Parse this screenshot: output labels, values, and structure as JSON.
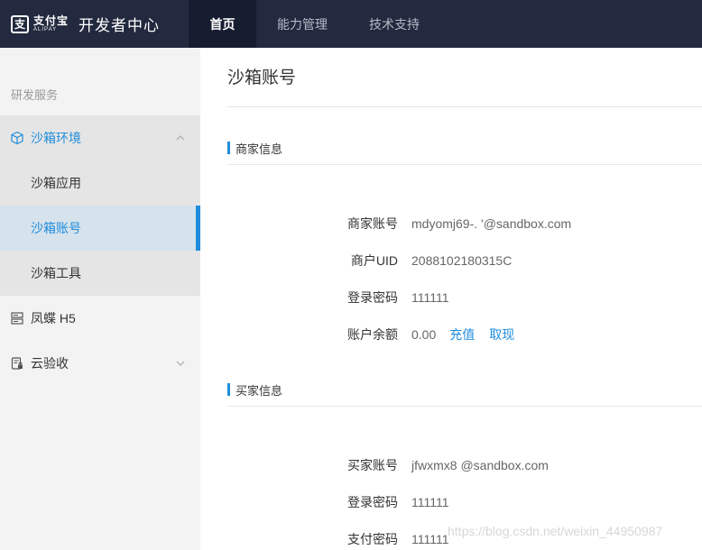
{
  "header": {
    "logo_cn": "支付宝",
    "logo_en": "ALIPAY",
    "title": "开发者中心",
    "tabs": [
      {
        "label": "首页"
      },
      {
        "label": "能力管理"
      },
      {
        "label": "技术支持"
      }
    ]
  },
  "sidebar": {
    "section_label": "研发服务",
    "items": [
      {
        "label": "沙箱环境",
        "icon": "cube-icon",
        "expanded": true
      },
      {
        "label": "沙箱应用"
      },
      {
        "label": "沙箱账号",
        "selected": true
      },
      {
        "label": "沙箱工具"
      },
      {
        "label": "凤蝶 H5",
        "icon": "server-icon"
      },
      {
        "label": "云验收",
        "icon": "clipboard-lock-icon",
        "expanded": false
      }
    ]
  },
  "main": {
    "title": "沙箱账号",
    "merchant": {
      "heading": "商家信息",
      "fields": [
        {
          "label": "商家账号",
          "value": "mdyomj69-. '@sandbox.com"
        },
        {
          "label": "商户UID",
          "value": "2088102180315C"
        },
        {
          "label": "登录密码",
          "value": "111111"
        },
        {
          "label": "账户余额",
          "value": "0.00"
        }
      ],
      "links": {
        "recharge": "充值",
        "withdraw": "取现"
      }
    },
    "buyer": {
      "heading": "买家信息",
      "fields": [
        {
          "label": "买家账号",
          "value": "jfwxmx8     @sandbox.com"
        },
        {
          "label": "登录密码",
          "value": "111111"
        },
        {
          "label": "支付密码",
          "value": "111111"
        }
      ]
    }
  },
  "watermark": "https://blog.csdn.net/weixin_44950987",
  "colors": {
    "topbar": "#232a3f",
    "accent": "#1f8ddc",
    "sidebar_bg": "#f3f3f3"
  }
}
